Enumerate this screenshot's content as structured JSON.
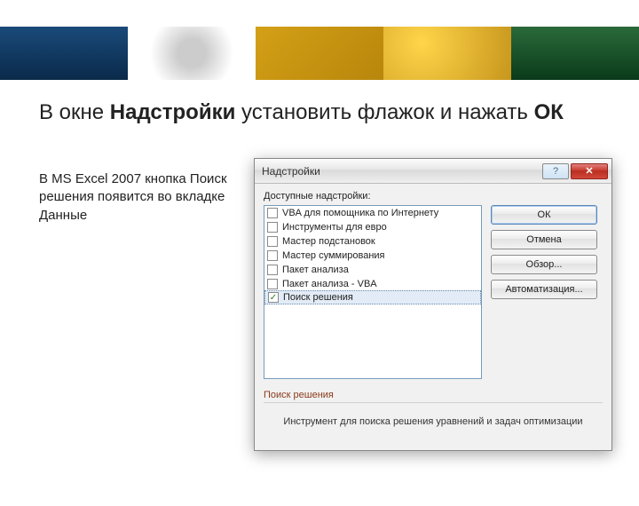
{
  "heading": {
    "pre": "В окне ",
    "bold1": "Надстройки",
    "mid": " установить флажок и нажать ",
    "bold2": "ОК"
  },
  "subtext": "В MS Excel 2007 кнопка Поиск решения появится во вкладке Данные",
  "dialog": {
    "title": "Надстройки",
    "label": "Доступные надстройки:",
    "items": [
      {
        "label": "VBA для помощника по Интернету",
        "checked": false,
        "selected": false
      },
      {
        "label": "Инструменты для евро",
        "checked": false,
        "selected": false
      },
      {
        "label": "Мастер подстановок",
        "checked": false,
        "selected": false
      },
      {
        "label": "Мастер суммирования",
        "checked": false,
        "selected": false
      },
      {
        "label": "Пакет анализа",
        "checked": false,
        "selected": false
      },
      {
        "label": "Пакет анализа - VBA",
        "checked": false,
        "selected": false
      },
      {
        "label": "Поиск решения",
        "checked": true,
        "selected": true
      }
    ],
    "buttons": {
      "ok": "ОК",
      "cancel": "Отмена",
      "browse": "Обзор...",
      "automation": "Автоматизация..."
    },
    "section_title": "Поиск решения",
    "description": "Инструмент для поиска решения уравнений и задач оптимизации"
  }
}
